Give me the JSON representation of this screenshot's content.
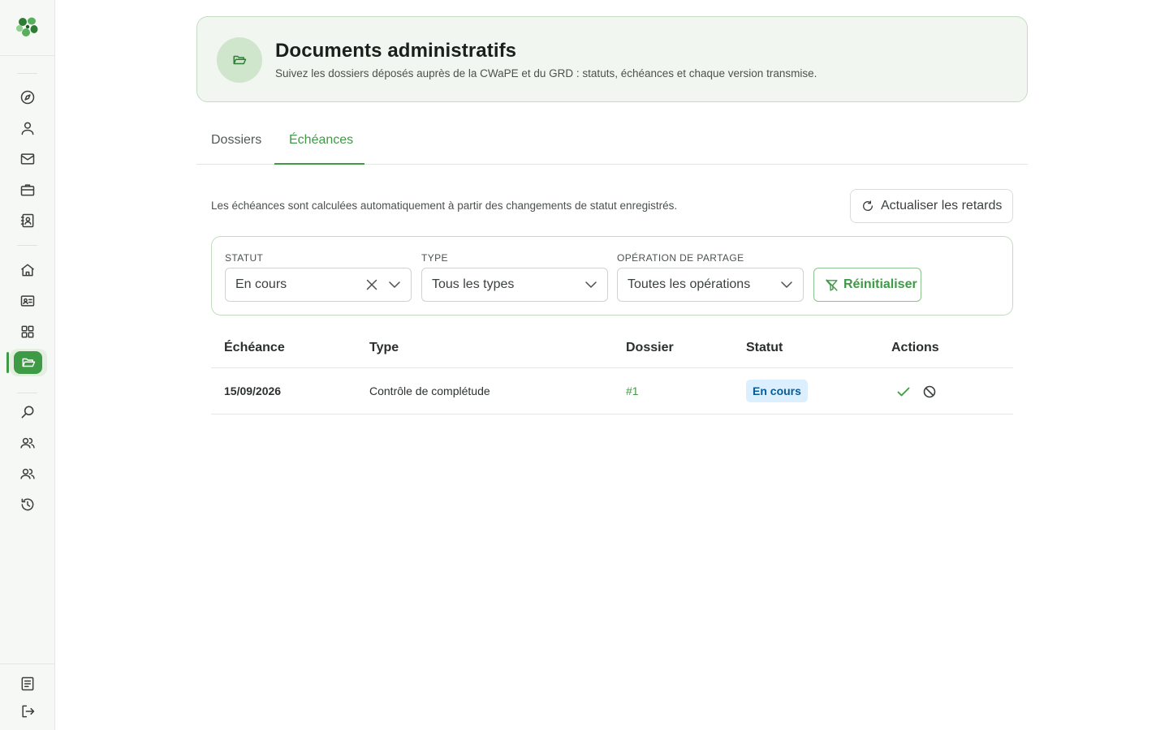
{
  "header": {
    "title": "Documents administratifs",
    "subtitle": "Suivez les dossiers déposés auprès de la CWaPE et du GRD : statuts, échéances et chaque version transmise."
  },
  "tabs": [
    {
      "label": "Dossiers",
      "active": false
    },
    {
      "label": "Échéances",
      "active": true
    }
  ],
  "info": {
    "text": "Les échéances sont calculées automatiquement à partir des changements de statut enregistrés.",
    "refresh_label": "Actualiser les retards"
  },
  "filters": {
    "status": {
      "label": "Statut",
      "value": "En cours"
    },
    "type": {
      "label": "Type",
      "value": "Tous les types"
    },
    "operation": {
      "label": "Opération de partage",
      "value": "Toutes les opérations"
    },
    "reset_label": "Réinitialiser"
  },
  "table": {
    "columns": [
      "Échéance",
      "Type",
      "Dossier",
      "Statut",
      "Actions"
    ],
    "rows": [
      {
        "date": "15/09/2026",
        "type": "Contrôle de complétude",
        "dossier": "#1",
        "status": "En cours"
      }
    ]
  },
  "sidebar": {
    "icons": [
      "compass-icon",
      "user-icon",
      "mail-icon",
      "briefcase-icon",
      "contact-card-icon",
      "home-icon",
      "id-card-icon",
      "grid-icon",
      "folder-open-icon",
      "search-icon",
      "users-icon",
      "users-group-icon",
      "history-icon",
      "document-icon",
      "logout-icon"
    ],
    "active": "folder-open-icon"
  },
  "colors": {
    "accent": "#3f9a45",
    "header_bg": "#f1f7f0",
    "badge_bg": "#dcefff",
    "badge_text": "#0a5a94"
  }
}
